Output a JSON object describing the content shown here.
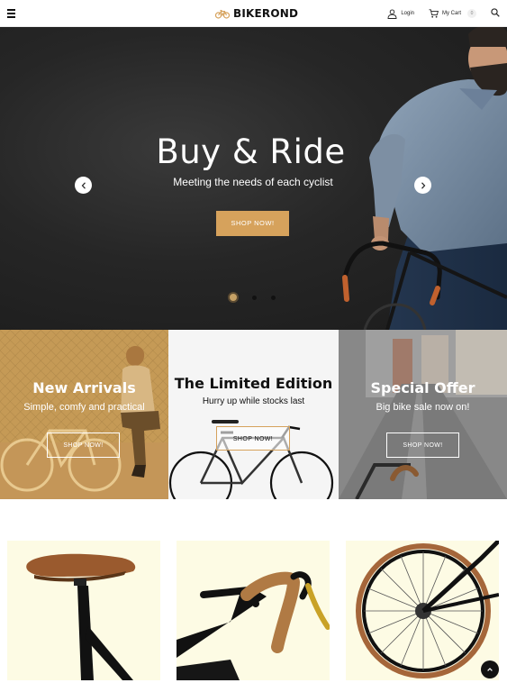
{
  "header": {
    "logo_text": "BIKEROND",
    "login_label": "Login",
    "cart_label": "My Cart",
    "cart_count": "0"
  },
  "hero": {
    "title": "Buy & Ride",
    "subtitle": "Meeting the needs of each cyclist",
    "button_label": "SHOP NOW!",
    "slides": 3,
    "active_slide": 1
  },
  "banners": [
    {
      "title": "New Arrivals",
      "subtitle": "Simple, comfy and practical",
      "button_label": "SHOP NOW!"
    },
    {
      "title": "The Limited Edition",
      "subtitle": "Hurry up while stocks last",
      "button_label": "SHOP NOW!"
    },
    {
      "title": "Special Offer",
      "subtitle": "Big bike sale now on!",
      "button_label": "SHOP NOW!"
    }
  ],
  "products": [
    {
      "image": "bike-saddle"
    },
    {
      "image": "bike-handlebar"
    },
    {
      "image": "bike-wheel"
    }
  ],
  "colors": {
    "accent": "#d6a25c",
    "hero_bg": "#262626",
    "product_bg": "#fdfbe4"
  }
}
